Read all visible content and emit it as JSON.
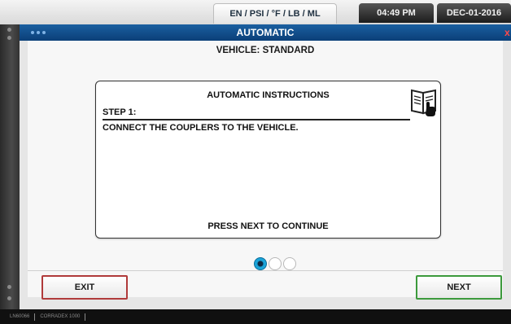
{
  "status": {
    "units": "EN / PSI / °F / LB / ML",
    "time": "04:49 PM",
    "date": "DEC-01-2016"
  },
  "window": {
    "title": "AUTOMATIC",
    "close_glyph": "x"
  },
  "vehicle_line": "VEHICLE: STANDARD",
  "instructions": {
    "title": "AUTOMATIC INSTRUCTIONS",
    "step_label": "STEP 1:",
    "step_text": "CONNECT THE COUPLERS TO THE VEHICLE.",
    "footer": "PRESS NEXT TO CONTINUE",
    "icon": "manual-book-icon"
  },
  "pagination": {
    "total": 3,
    "current": 1
  },
  "buttons": {
    "exit": "EXIT",
    "next": "NEXT"
  },
  "colors": {
    "titlebar": "#0b3f78",
    "exit_border": "#b03a3a",
    "next_border": "#3c9a3c",
    "page_active": "#1aa3d8"
  },
  "bottom_bar": {
    "item1": "LN60066",
    "item2": "CORRADEX 1000"
  }
}
